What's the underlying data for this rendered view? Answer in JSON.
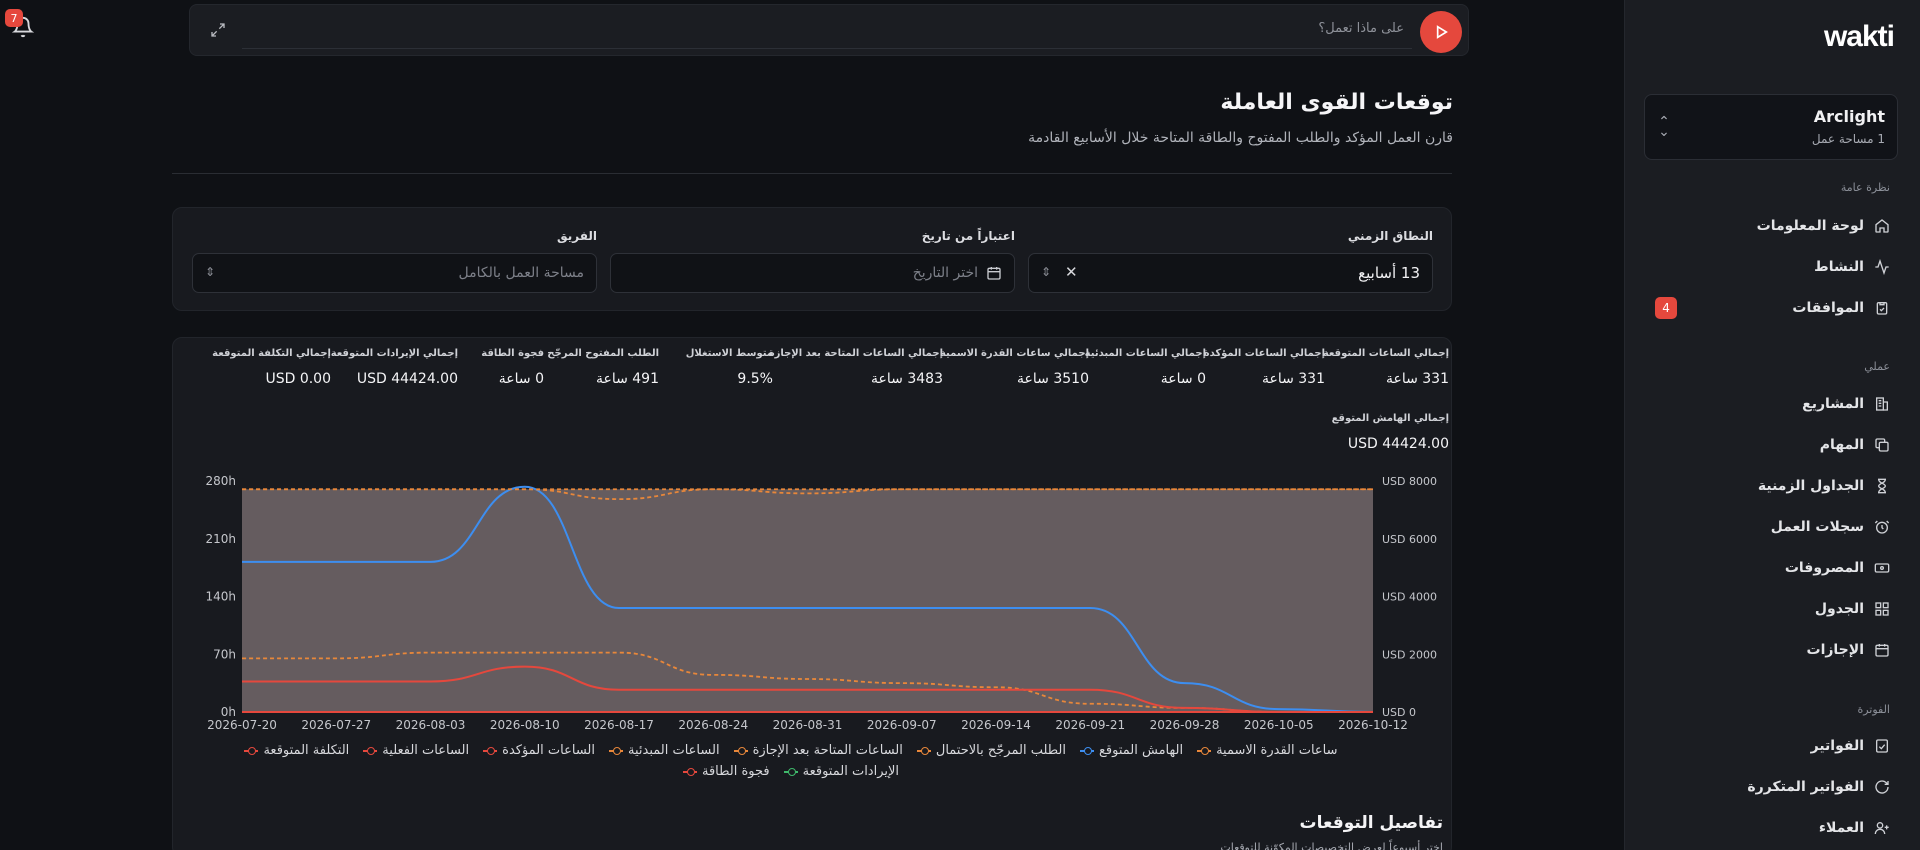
{
  "notifications": {
    "count": "7"
  },
  "command_bar": {
    "placeholder": "على ماذا تعمل؟"
  },
  "header": {
    "title": "توقعات القوى العاملة",
    "subtitle": "قارن العمل المؤكد والطلب المفتوح والطاقة المتاحة خلال الأسابيع القادمة"
  },
  "filters": {
    "range_label": "النطاق الزمني",
    "range_value": "13 أسابيع",
    "from_label": "اعتباراً من تاريخ",
    "from_placeholder": "اختر التاريخ",
    "team_label": "الفريق",
    "team_placeholder": "مساحة العمل بالكامل"
  },
  "stats": [
    {
      "label": "إجمالي الساعات المتوقعة",
      "value": "331 ساعة"
    },
    {
      "label": "إجمالي الساعات المؤكدة",
      "value": "331 ساعة"
    },
    {
      "label": "إجمالي الساعات المبدئية",
      "value": "0 ساعة"
    },
    {
      "label": "إجمالي ساعات القدرة الاسمية",
      "value": "3510 ساعة"
    },
    {
      "label": "إجمالي الساعات المتاحة بعد الإجازة",
      "value": "3483 ساعة"
    },
    {
      "label": "متوسط الاستغلال",
      "value": "9.5%"
    },
    {
      "label": "الطلب المفتوح المرجّح",
      "value": "491 ساعة"
    },
    {
      "label": "فجوة الطاقة",
      "value": "0 ساعة"
    },
    {
      "label": "إجمالي الإيرادات المتوقعة",
      "value": "USD 44424.00"
    },
    {
      "label": "إجمالي التكلفة المتوقعة",
      "value": "USD 0.00"
    }
  ],
  "margin_stat": {
    "label": "إجمالي الهامش المتوقع",
    "value": "USD 44424.00"
  },
  "chart_data": {
    "type": "line",
    "x": [
      "2026-07-20",
      "2026-07-27",
      "2026-08-03",
      "2026-08-10",
      "2026-08-17",
      "2026-08-24",
      "2026-08-31",
      "2026-09-07",
      "2026-09-14",
      "2026-09-21",
      "2026-09-28",
      "2026-10-05",
      "2026-10-12"
    ],
    "y_left": {
      "ticks": [
        "0h",
        "70h",
        "140h",
        "210h",
        "280h"
      ],
      "range": [
        0,
        280
      ]
    },
    "y_right": {
      "ticks": [
        "USD 0",
        "USD 2000",
        "USD 4000",
        "USD 6000",
        "USD 8000"
      ],
      "range": [
        0,
        8000
      ]
    },
    "series": [
      {
        "name": "ساعات القدرة الاسمية",
        "axis": "left",
        "color": "#e8873a",
        "style": "dashed",
        "values": [
          270,
          270,
          270,
          270,
          270,
          270,
          270,
          270,
          270,
          270,
          270,
          270,
          270
        ]
      },
      {
        "name": "الهامش المتوقع",
        "axis": "right",
        "color": "#3d8ef0",
        "style": "solid",
        "values": [
          5200,
          5200,
          5200,
          7800,
          3600,
          3600,
          3600,
          3600,
          3600,
          3600,
          1000,
          100,
          0
        ]
      },
      {
        "name": "الطلب المرجّح بالاحتمال",
        "axis": "left",
        "color": "#e8873a",
        "style": "dashed",
        "values": [
          65,
          65,
          72,
          72,
          72,
          45,
          40,
          35,
          30,
          10,
          5,
          0,
          0
        ]
      },
      {
        "name": "الساعات المتاحة بعد الإجازة",
        "axis": "left",
        "color": "#e8873a",
        "style": "dashed",
        "values": [
          270,
          270,
          270,
          270,
          258,
          270,
          265,
          270,
          270,
          270,
          270,
          270,
          270
        ]
      },
      {
        "name": "الساعات المبدئية",
        "axis": "left",
        "color": "#e8873a",
        "style": "dashed",
        "values": [
          0,
          0,
          0,
          0,
          0,
          0,
          0,
          0,
          0,
          0,
          0,
          0,
          0
        ]
      },
      {
        "name": "الساعات المؤكدة",
        "axis": "left",
        "color": "#e5483d",
        "style": "solid",
        "values": [
          37,
          37,
          37,
          55,
          27,
          27,
          27,
          27,
          27,
          27,
          5,
          0,
          0
        ]
      },
      {
        "name": "الساعات الفعلية",
        "axis": "left",
        "color": "#e5483d",
        "style": "solid",
        "values": [
          0,
          0,
          0,
          0,
          0,
          0,
          0,
          0,
          0,
          0,
          0,
          0,
          0
        ]
      },
      {
        "name": "التكلفة المتوقعة",
        "axis": "right",
        "color": "#e5483d",
        "style": "solid",
        "values": [
          0,
          0,
          0,
          0,
          0,
          0,
          0,
          0,
          0,
          0,
          0,
          0,
          0
        ]
      },
      {
        "name": "الإيرادات المتوقعة",
        "axis": "right",
        "color": "#3fb96b",
        "style": "solid",
        "values": [
          0,
          0,
          0,
          0,
          0,
          0,
          0,
          0,
          0,
          0,
          0,
          0,
          0
        ]
      },
      {
        "name": "فجوة الطاقة",
        "axis": "left",
        "color": "#e5483d",
        "style": "solid",
        "values": [
          0,
          0,
          0,
          0,
          0,
          0,
          0,
          0,
          0,
          0,
          0,
          0,
          0
        ]
      }
    ],
    "grid": false,
    "legend_position": "bottom"
  },
  "details": {
    "title": "تفاصيل التوقعات",
    "subtitle": "اختر أسبوعاً لعرض التخصيصات المكوّنة للتوقعات"
  },
  "sidebar": {
    "logo": "wakti",
    "workspace": {
      "name": "Arclight",
      "sub": "1 مساحة عمل"
    },
    "sections": [
      {
        "title": "نظرة عامة",
        "items": [
          {
            "label": "لوحة المعلومات",
            "icon": "home-icon"
          },
          {
            "label": "النشاط",
            "icon": "activity-icon"
          },
          {
            "label": "الموافقات",
            "icon": "clipboard-check-icon",
            "badge": "4"
          }
        ]
      },
      {
        "title": "عملي",
        "items": [
          {
            "label": "المشاريع",
            "icon": "building-icon"
          },
          {
            "label": "المهام",
            "icon": "copy-icon"
          },
          {
            "label": "الجداول الزمنية",
            "icon": "hourglass-icon"
          },
          {
            "label": "سجلات العمل",
            "icon": "alarm-icon"
          },
          {
            "label": "المصروفات",
            "icon": "banknote-icon"
          },
          {
            "label": "الجدول",
            "icon": "grid-icon"
          },
          {
            "label": "الإجازات",
            "icon": "calendar-icon"
          }
        ]
      },
      {
        "title": "الفوترة",
        "items": [
          {
            "label": "الفواتير",
            "icon": "invoice-icon"
          },
          {
            "label": "الفواتير المتكررة",
            "icon": "refresh-icon"
          },
          {
            "label": "العملاء",
            "icon": "user-plus-icon"
          }
        ]
      }
    ]
  }
}
